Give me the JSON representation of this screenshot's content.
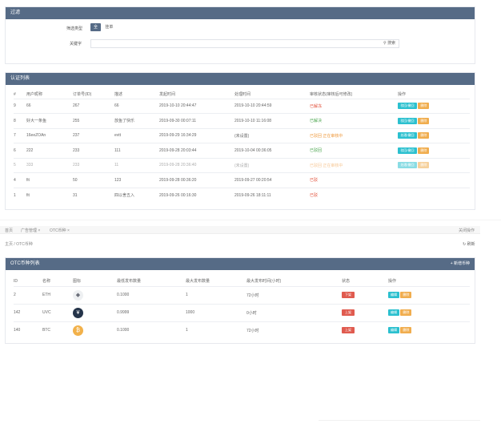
{
  "filter": {
    "title": "过滤",
    "type_label": "筛选类型",
    "type_options": [
      "全",
      "挂单"
    ],
    "keyword_label": "关键字",
    "search_label": "搜索"
  },
  "list": {
    "title": "认证列表",
    "columns": [
      "#",
      "用户昵称",
      "订单号(ID)",
      "描述",
      "发起时间",
      "处理时间",
      "审核状态(审核后可修改)",
      "操作"
    ],
    "rows": [
      {
        "id": "9",
        "name": "66",
        "order": "267",
        "desc": "66",
        "start": "2019-10-10 20:44:47",
        "end": "2019-10-10 20:44:59",
        "status": "已解冻",
        "status_color": "red",
        "btn1": "驳回/撤回",
        "btn2": "删除",
        "faded": false
      },
      {
        "id": "8",
        "name": "好大一条鱼",
        "order": "255",
        "desc": "放鱼了快乐",
        "start": "2019-09-30 00:07:11",
        "end": "2019-10-10 11:16:08",
        "status": "已解决",
        "status_color": "green",
        "btn1": "驳回/撤回",
        "btn2": "删除",
        "faded": false
      },
      {
        "id": "7",
        "name": "16eeZOAn",
        "order": "237",
        "desc": "evtt",
        "start": "2019-09-29 16:34:29",
        "end": "(未设置)",
        "status": "已驳回 正在审核中",
        "status_color": "orange",
        "btn1": "处理/撤回",
        "btn2": "删除",
        "faded": false
      },
      {
        "id": "6",
        "name": "222",
        "order": "233",
        "desc": "111",
        "start": "2019-09-28 20:03:44",
        "end": "2019-10-04 00:36:05",
        "status": "已驳回",
        "status_color": "green",
        "btn1": "驳回/撤回",
        "btn2": "删除",
        "faded": false
      },
      {
        "id": "5",
        "name": "333",
        "order": "233",
        "desc": "11",
        "start": "2019-09-28 20:36:40",
        "end": "(未设置)",
        "status": "已驳回 正在审核中",
        "status_color": "orange",
        "btn1": "处理/撤回",
        "btn2": "删除",
        "faded": true
      },
      {
        "id": "4",
        "name": "fit",
        "order": "50",
        "desc": "123",
        "start": "2019-09-28 00:36:20",
        "end": "2019-09-27 00:20:54",
        "status": "已驳",
        "status_color": "red",
        "btn1": "",
        "btn2": "",
        "faded": false
      },
      {
        "id": "1",
        "name": "fit",
        "order": "31",
        "desc": "四以舍五入",
        "start": "2019-09-26 00:16:30",
        "end": "2019-09-26 18:11:11",
        "status": "已驳",
        "status_color": "red",
        "btn1": "",
        "btn2": "",
        "faded": false
      }
    ]
  },
  "window2": {
    "tabs": [
      "首页",
      "广告管理 ×",
      "OTC币种 ×"
    ],
    "right_tab": "关闭操作",
    "crumb": "主页 / OTC币种",
    "refresh_label": "刷新",
    "panel_title": "OTC币种列表",
    "add_label": "+ 新增币种",
    "columns": [
      "ID",
      "名称",
      "图标",
      "最低发布数量",
      "最大发布数量",
      "最大发布时间(小时)",
      "状态",
      "操作"
    ],
    "rows": [
      {
        "id": "2",
        "name": "ETH",
        "icon": "eth-icon",
        "min": "0.1000",
        "max": "1",
        "hours": "72小时",
        "status": "下架",
        "status_color": "#e05b4f",
        "op1": "编辑",
        "op2": "删除"
      },
      {
        "id": "142",
        "name": "UVC",
        "icon": "uvc-icon",
        "min": "0.9999",
        "max": "1000",
        "hours": "0小时",
        "status": "上架",
        "status_color": "#e05b4f",
        "op1": "编辑",
        "op2": "删除"
      },
      {
        "id": "140",
        "name": "BTC",
        "icon": "btc-icon",
        "min": "0.1000",
        "max": "1",
        "hours": "72小时",
        "status": "上架",
        "status_color": "#e05b4f",
        "op1": "编辑",
        "op2": "删除"
      }
    ]
  },
  "colors": {
    "header": "#566b86",
    "cyan": "#2bc0cf",
    "orange": "#f0ad4e",
    "red": "#e05b4f"
  }
}
